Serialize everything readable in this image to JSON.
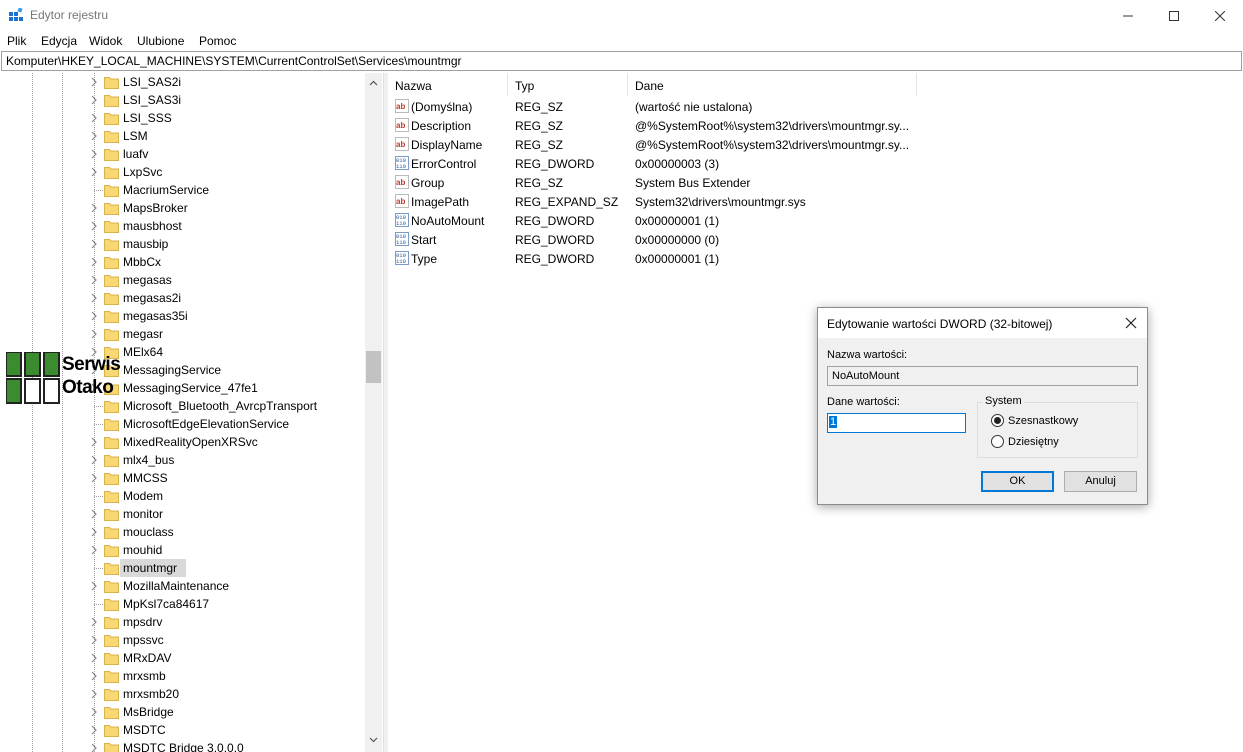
{
  "window": {
    "title": "Edytor rejestru",
    "minimize_icon": "minimize-icon",
    "maximize_icon": "maximize-icon",
    "close_icon": "close-icon"
  },
  "menu": [
    "Plik",
    "Edycja",
    "Widok",
    "Ulubione",
    "Pomoc"
  ],
  "address": "Komputer\\HKEY_LOCAL_MACHINE\\SYSTEM\\CurrentControlSet\\Services\\mountmgr",
  "tree": {
    "selected": "mountmgr",
    "items": [
      {
        "label": "LSI_SAS2i",
        "expandable": true
      },
      {
        "label": "LSI_SAS3i",
        "expandable": true
      },
      {
        "label": "LSI_SSS",
        "expandable": true
      },
      {
        "label": "LSM",
        "expandable": true
      },
      {
        "label": "luafv",
        "expandable": true
      },
      {
        "label": "LxpSvc",
        "expandable": true
      },
      {
        "label": "MacriumService",
        "expandable": false
      },
      {
        "label": "MapsBroker",
        "expandable": true
      },
      {
        "label": "mausbhost",
        "expandable": true
      },
      {
        "label": "mausbip",
        "expandable": true
      },
      {
        "label": "MbbCx",
        "expandable": true
      },
      {
        "label": "megasas",
        "expandable": true
      },
      {
        "label": "megasas2i",
        "expandable": true
      },
      {
        "label": "megasas35i",
        "expandable": true
      },
      {
        "label": "megasr",
        "expandable": true
      },
      {
        "label": "MElx64",
        "expandable": true
      },
      {
        "label": "MessagingService",
        "expandable": true
      },
      {
        "label": "MessagingService_47fe1",
        "expandable": true
      },
      {
        "label": "Microsoft_Bluetooth_AvrcpTransport",
        "expandable": false
      },
      {
        "label": "MicrosoftEdgeElevationService",
        "expandable": false
      },
      {
        "label": "MixedRealityOpenXRSvc",
        "expandable": true
      },
      {
        "label": "mlx4_bus",
        "expandable": true
      },
      {
        "label": "MMCSS",
        "expandable": true
      },
      {
        "label": "Modem",
        "expandable": false
      },
      {
        "label": "monitor",
        "expandable": true
      },
      {
        "label": "mouclass",
        "expandable": true
      },
      {
        "label": "mouhid",
        "expandable": true
      },
      {
        "label": "mountmgr",
        "expandable": false
      },
      {
        "label": "MozillaMaintenance",
        "expandable": true
      },
      {
        "label": "MpKsl7ca84617",
        "expandable": false
      },
      {
        "label": "mpsdrv",
        "expandable": true
      },
      {
        "label": "mpssvc",
        "expandable": true
      },
      {
        "label": "MRxDAV",
        "expandable": true
      },
      {
        "label": "mrxsmb",
        "expandable": true
      },
      {
        "label": "mrxsmb20",
        "expandable": true
      },
      {
        "label": "MsBridge",
        "expandable": true
      },
      {
        "label": "MSDTC",
        "expandable": true
      },
      {
        "label": "MSDTC Bridge 3.0.0.0",
        "expandable": true
      }
    ]
  },
  "watermark": {
    "line1": "Serwis",
    "line2": "Otako",
    "color": "#3a8c2f"
  },
  "list": {
    "columns": [
      "Nazwa",
      "Typ",
      "Dane"
    ],
    "rows": [
      {
        "icon": "string-value-icon",
        "name": "(Domyślna)",
        "type": "REG_SZ",
        "data": "(wartość nie ustalona)"
      },
      {
        "icon": "string-value-icon",
        "name": "Description",
        "type": "REG_SZ",
        "data": "@%SystemRoot%\\system32\\drivers\\mountmgr.sy..."
      },
      {
        "icon": "string-value-icon",
        "name": "DisplayName",
        "type": "REG_SZ",
        "data": "@%SystemRoot%\\system32\\drivers\\mountmgr.sy..."
      },
      {
        "icon": "binary-value-icon",
        "name": "ErrorControl",
        "type": "REG_DWORD",
        "data": "0x00000003 (3)"
      },
      {
        "icon": "string-value-icon",
        "name": "Group",
        "type": "REG_SZ",
        "data": "System Bus Extender"
      },
      {
        "icon": "string-value-icon",
        "name": "ImagePath",
        "type": "REG_EXPAND_SZ",
        "data": "System32\\drivers\\mountmgr.sys"
      },
      {
        "icon": "binary-value-icon",
        "name": "NoAutoMount",
        "type": "REG_DWORD",
        "data": "0x00000001 (1)"
      },
      {
        "icon": "binary-value-icon",
        "name": "Start",
        "type": "REG_DWORD",
        "data": "0x00000000 (0)"
      },
      {
        "icon": "binary-value-icon",
        "name": "Type",
        "type": "REG_DWORD",
        "data": "0x00000001 (1)"
      }
    ]
  },
  "dialog": {
    "title": "Edytowanie wartości DWORD (32-bitowej)",
    "value_name_label": "Nazwa wartości:",
    "value_name": "NoAutoMount",
    "value_data_label": "Dane wartości:",
    "value_data": "1",
    "base_group_label": "System",
    "base_hex_label": "Szesnastkowy",
    "base_dec_label": "Dziesiętny",
    "base_selected": "Szesnastkowy",
    "ok_label": "OK",
    "cancel_label": "Anuluj"
  },
  "colors": {
    "folder": "#f8d775",
    "accent": "#0078d7",
    "selection": "#d9d9d9"
  }
}
